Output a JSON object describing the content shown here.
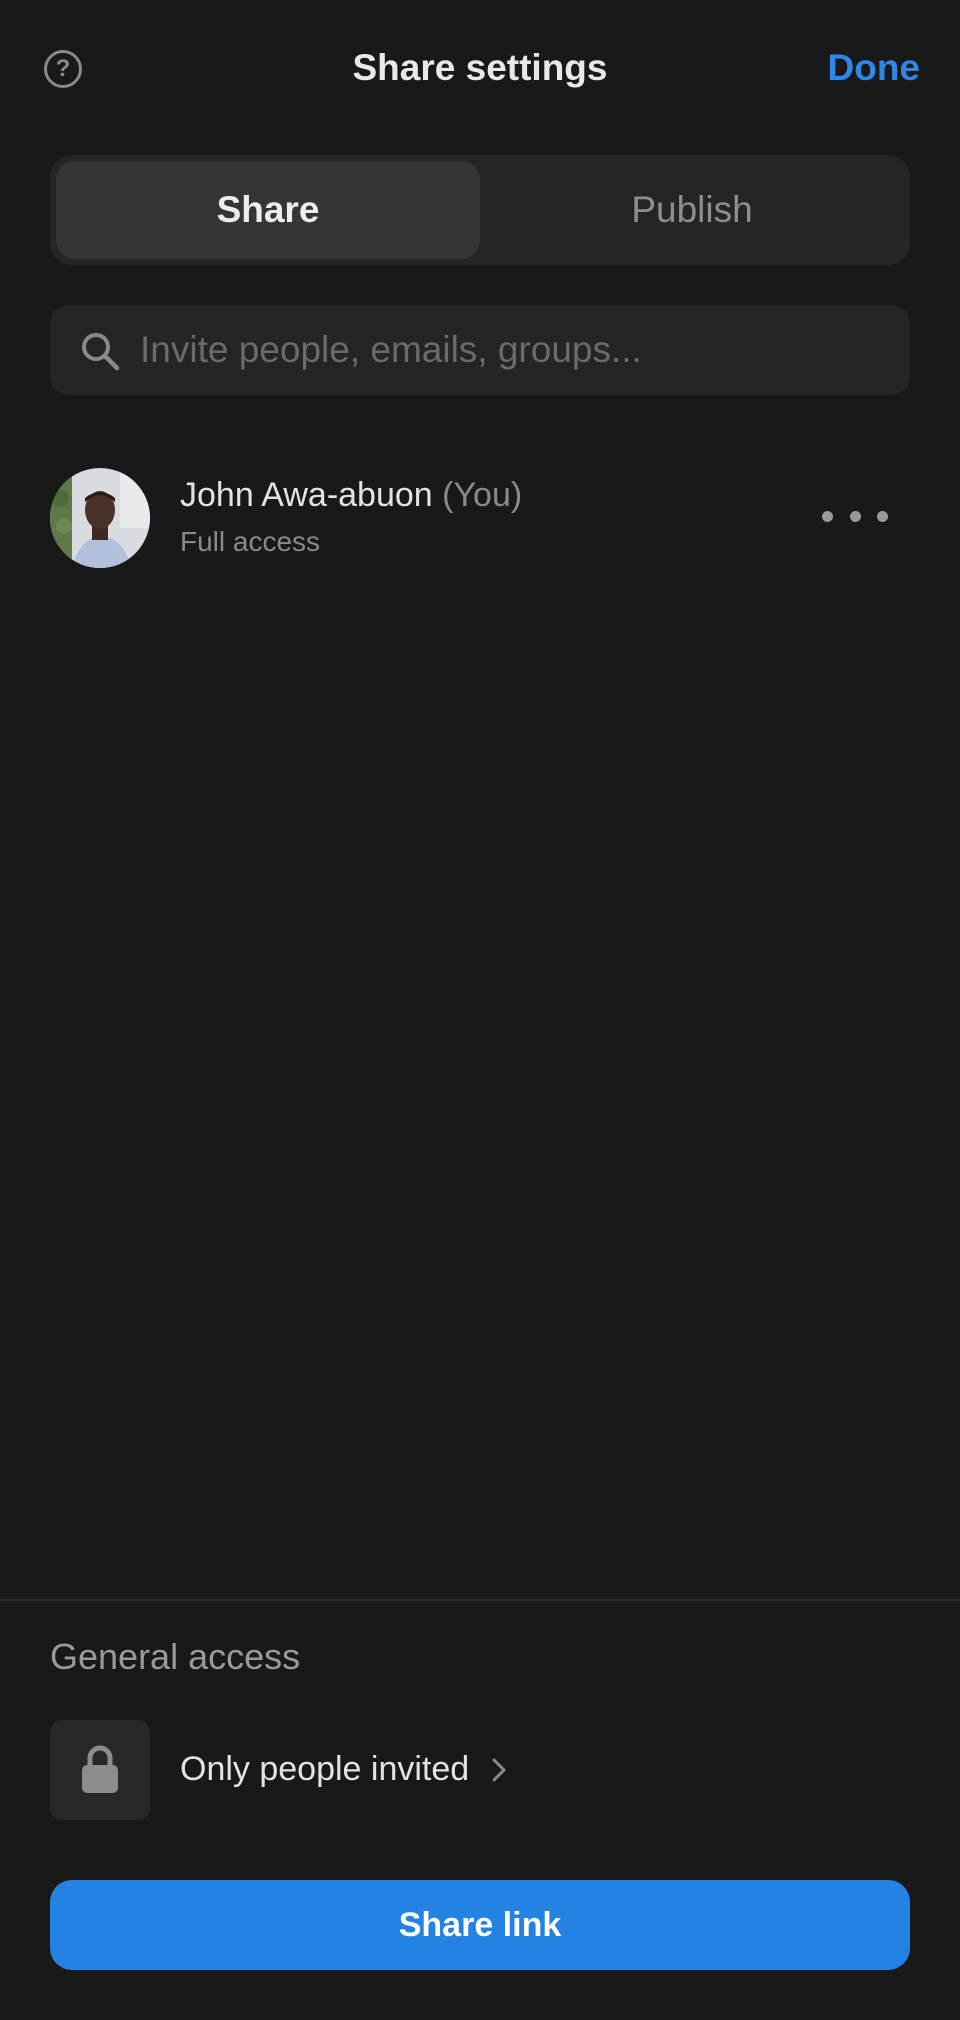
{
  "header": {
    "title": "Share settings",
    "done_label": "Done",
    "help_icon": "question-circle-icon"
  },
  "tabs": [
    {
      "label": "Share",
      "active": true
    },
    {
      "label": "Publish",
      "active": false
    }
  ],
  "search": {
    "placeholder": "Invite people, emails, groups...",
    "value": "",
    "icon": "search-icon"
  },
  "members": [
    {
      "name": "John Awa-abuon",
      "suffix": "(You)",
      "access": "Full access",
      "more_icon": "more-horizontal-icon"
    }
  ],
  "general_access": {
    "section_label": "General access",
    "option_label": "Only people invited",
    "icon": "lock-icon",
    "chevron_icon": "chevron-right-icon"
  },
  "share_link": {
    "label": "Share link"
  },
  "colors": {
    "background": "#191919",
    "surface": "#252525",
    "accent": "#2382e2",
    "done_text": "#2f86e6"
  }
}
